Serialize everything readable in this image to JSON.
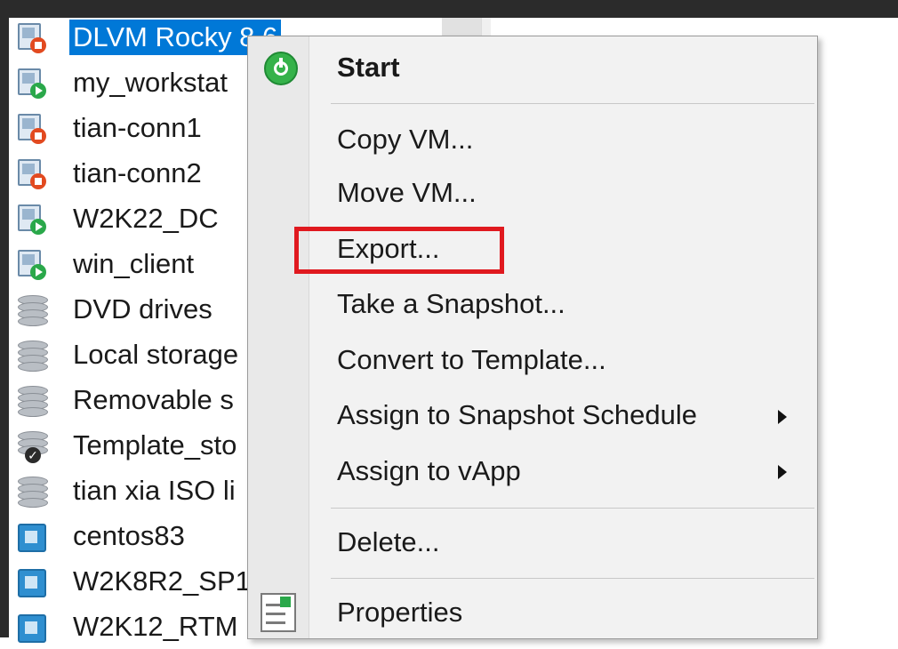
{
  "tree": {
    "items": [
      {
        "label": "DLVM Rocky 8.6",
        "type": "vm",
        "status": "halted",
        "selected": true
      },
      {
        "label": "my_workstat",
        "type": "vm",
        "status": "running"
      },
      {
        "label": "tian-conn1",
        "type": "vm",
        "status": "halted"
      },
      {
        "label": "tian-conn2",
        "type": "vm",
        "status": "halted"
      },
      {
        "label": "W2K22_DC",
        "type": "vm",
        "status": "running"
      },
      {
        "label": "win_client",
        "type": "vm",
        "status": "running"
      },
      {
        "label": "DVD drives",
        "type": "storage"
      },
      {
        "label": "Local storage",
        "type": "storage"
      },
      {
        "label": "Removable s",
        "type": "storage"
      },
      {
        "label": "Template_sto",
        "type": "storage",
        "default": true
      },
      {
        "label": "tian xia ISO li",
        "type": "storage"
      },
      {
        "label": "centos83",
        "type": "template"
      },
      {
        "label": "W2K8R2_SP1",
        "type": "template"
      },
      {
        "label": "W2K12_RTM",
        "type": "template"
      }
    ]
  },
  "context_menu": {
    "start": "Start",
    "copy_vm": "Copy VM...",
    "move_vm": "Move VM...",
    "export": "Export...",
    "take_snapshot": "Take a Snapshot...",
    "convert_template": "Convert to Template...",
    "assign_snapshot_schedule": "Assign to Snapshot Schedule",
    "assign_vapp": "Assign to vApp",
    "delete": "Delete...",
    "properties": "Properties"
  },
  "colors": {
    "selection": "#0078d7",
    "highlight": "#e0191f",
    "running": "#2aa84a",
    "halted": "#e24a20"
  },
  "icons": {
    "start": "power-start-icon",
    "properties": "properties-icon"
  }
}
